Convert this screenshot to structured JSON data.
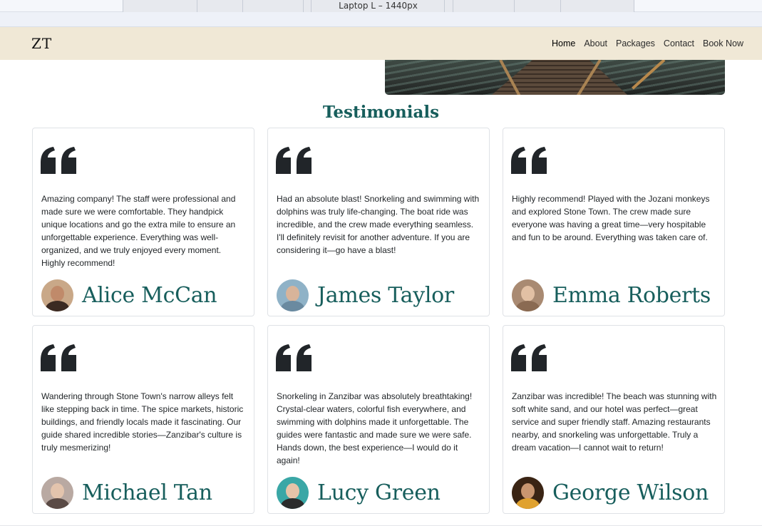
{
  "devtools": {
    "viewport_label": "Laptop L – 1440px"
  },
  "navbar": {
    "brand": "ZT",
    "links": [
      {
        "label": "Home",
        "active": true
      },
      {
        "label": "About",
        "active": false
      },
      {
        "label": "Packages",
        "active": false
      },
      {
        "label": "Contact",
        "active": false
      },
      {
        "label": "Book Now",
        "active": false
      }
    ]
  },
  "testimonials": {
    "title": "Testimonials",
    "quote_icon": "quote-open-icon",
    "items": [
      {
        "text": "Amazing company! The staff were professional and made sure we were comfortable. They handpick unique locations and go the extra mile to ensure an unforgettable experience. Everything was well-organized, and we truly enjoyed every moment. Highly recommend!",
        "name": "Alice McCan",
        "avatar_bg": "#c9a888",
        "face": "#c08a6a",
        "body": "#3b2a22"
      },
      {
        "text": "Had an absolute blast! Snorkeling and swimming with dolphins was truly life-changing. The boat ride was incredible, and the crew made everything seamless. I'll definitely revisit for another adventure. If you are considering it—go have a blast!",
        "name": "James Taylor",
        "avatar_bg": "#8fb2c7",
        "face": "#d8b49a",
        "body": "#6a8aa0"
      },
      {
        "text": "Highly recommend! Played with the Jozani monkeys and explored Stone Town. The crew made sure everyone was having a great time—very hospitable and fun to be around. Everything was taken care of.",
        "name": "Emma Roberts",
        "avatar_bg": "#a98a72",
        "face": "#e2c0a4",
        "body": "#8a6a52"
      },
      {
        "text": "Wandering through Stone Town's narrow alleys felt like stepping back in time. The spice markets, historic buildings, and friendly locals made it fascinating. Our guide shared incredible stories—Zanzibar's culture is truly mesmerizing!",
        "name": "Michael Tan",
        "avatar_bg": "#b9a9a2",
        "face": "#e3c4ad",
        "body": "#5a4a45"
      },
      {
        "text": "Snorkeling in Zanzibar was absolutely breathtaking! Crystal-clear waters, colorful fish everywhere, and swimming with dolphins made it unforgettable. The guides were fantastic and made sure we were safe. Hands down, the best experience—I would do it again!",
        "name": "Lucy Green",
        "avatar_bg": "#3aa7a6",
        "face": "#e6c3a8",
        "body": "#2b2b2b"
      },
      {
        "text": "Zanzibar was incredible! The beach was stunning with soft white sand, and our hotel was perfect—great service and super friendly staff. Amazing restaurants nearby, and snorkeling was unforgettable. Truly a dream vacation—I cannot wait to return!",
        "name": "George Wilson",
        "avatar_bg": "#3a2414",
        "face": "#c99670",
        "body": "#e0a230"
      }
    ]
  },
  "colors": {
    "accent": "#175e5c",
    "navbar_bg": "#f0e8d6",
    "quote_icon": "#212529"
  }
}
